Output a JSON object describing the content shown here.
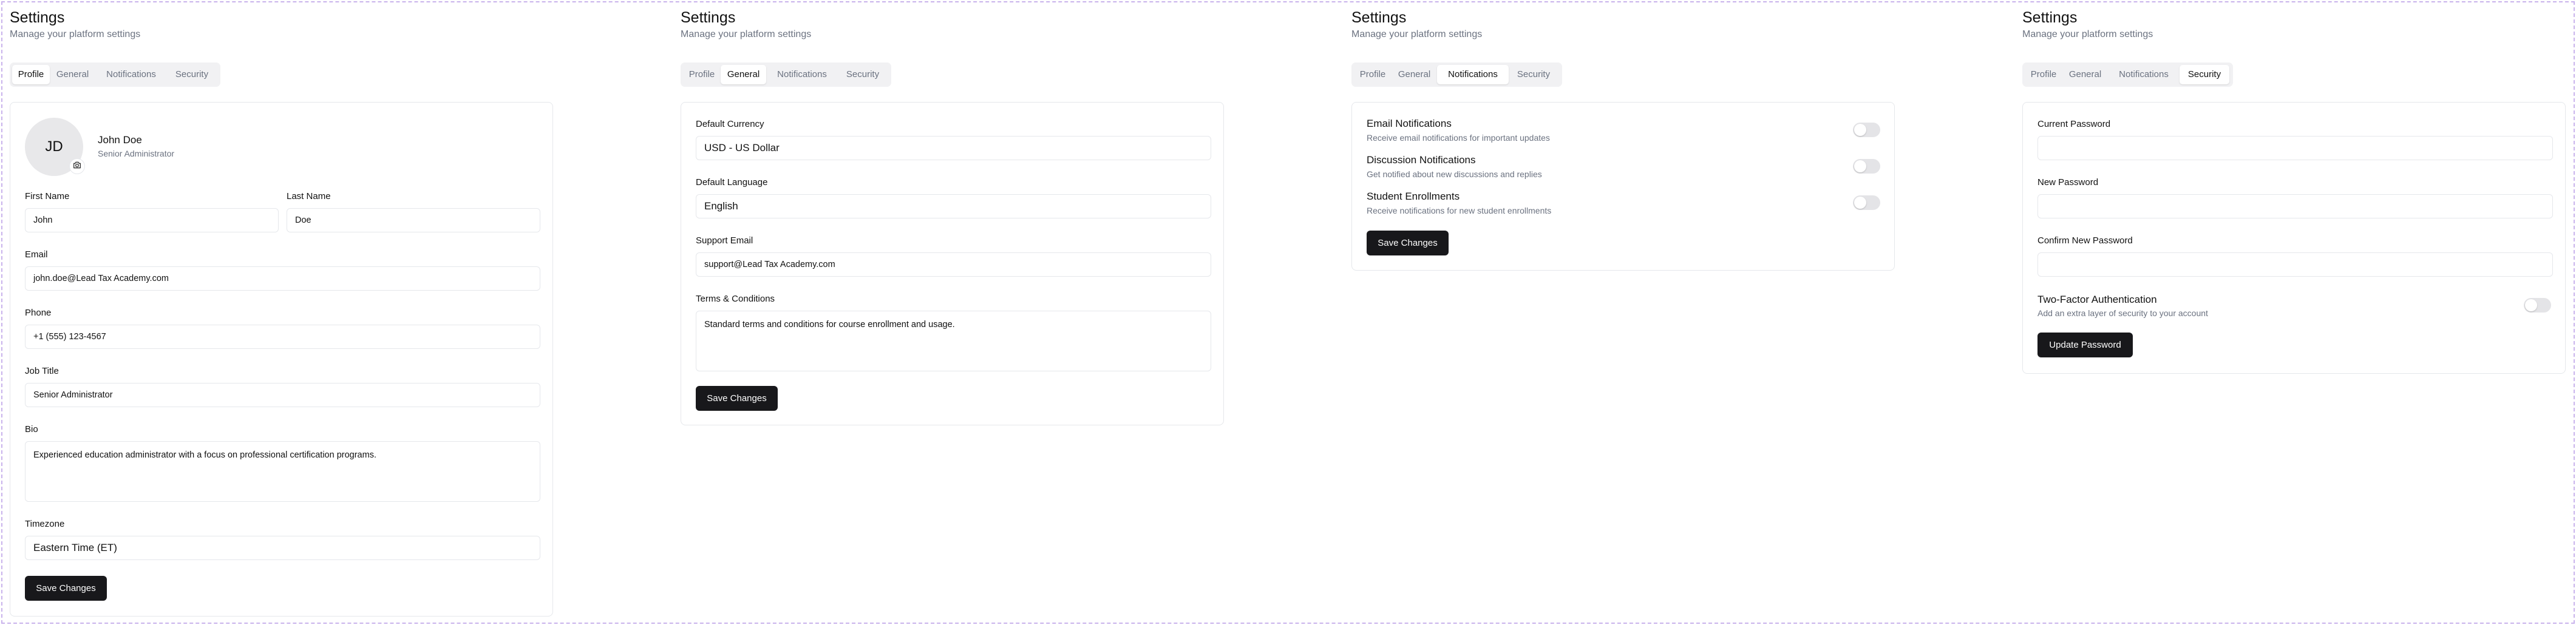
{
  "page": {
    "title": "Settings",
    "subtitle": "Manage your platform settings"
  },
  "tabs": [
    "Profile",
    "General",
    "Notifications",
    "Security"
  ],
  "profile": {
    "avatar_initials": "JD",
    "name": "John Doe",
    "role": "Senior Administrator",
    "first_name_label": "First Name",
    "first_name": "John",
    "last_name_label": "Last Name",
    "last_name": "Doe",
    "email_label": "Email",
    "email": "john.doe@Lead Tax Academy.com",
    "phone_label": "Phone",
    "phone": "+1 (555) 123-4567",
    "job_title_label": "Job Title",
    "job_title": "Senior Administrator",
    "bio_label": "Bio",
    "bio": "Experienced education administrator with a focus on professional certification programs.",
    "timezone_label": "Timezone",
    "timezone": "Eastern Time (ET)",
    "save_label": "Save Changes"
  },
  "general": {
    "currency_label": "Default Currency",
    "currency": "USD - US Dollar",
    "language_label": "Default Language",
    "language": "English",
    "support_email_label": "Support Email",
    "support_email": "support@Lead Tax Academy.com",
    "terms_label": "Terms & Conditions",
    "terms": "Standard terms and conditions for course enrollment and usage.",
    "save_label": "Save Changes"
  },
  "notifications": {
    "items": [
      {
        "title": "Email Notifications",
        "desc": "Receive email notifications for important updates",
        "enabled": false
      },
      {
        "title": "Discussion Notifications",
        "desc": "Get notified about new discussions and replies",
        "enabled": false
      },
      {
        "title": "Student Enrollments",
        "desc": "Receive notifications for new student enrollments",
        "enabled": false
      }
    ],
    "save_label": "Save Changes"
  },
  "security": {
    "current_password_label": "Current Password",
    "new_password_label": "New Password",
    "confirm_password_label": "Confirm New Password",
    "two_factor_title": "Two-Factor Authentication",
    "two_factor_desc": "Add an extra layer of security to your account",
    "two_factor_enabled": false,
    "update_label": "Update Password"
  },
  "colors": {
    "primary_button": "#18181b",
    "border": "#e5e7eb",
    "muted_text": "#6b7280",
    "frame_dashed": "#c9b3ec"
  },
  "icons": {
    "avatar_upload": "camera-icon"
  }
}
